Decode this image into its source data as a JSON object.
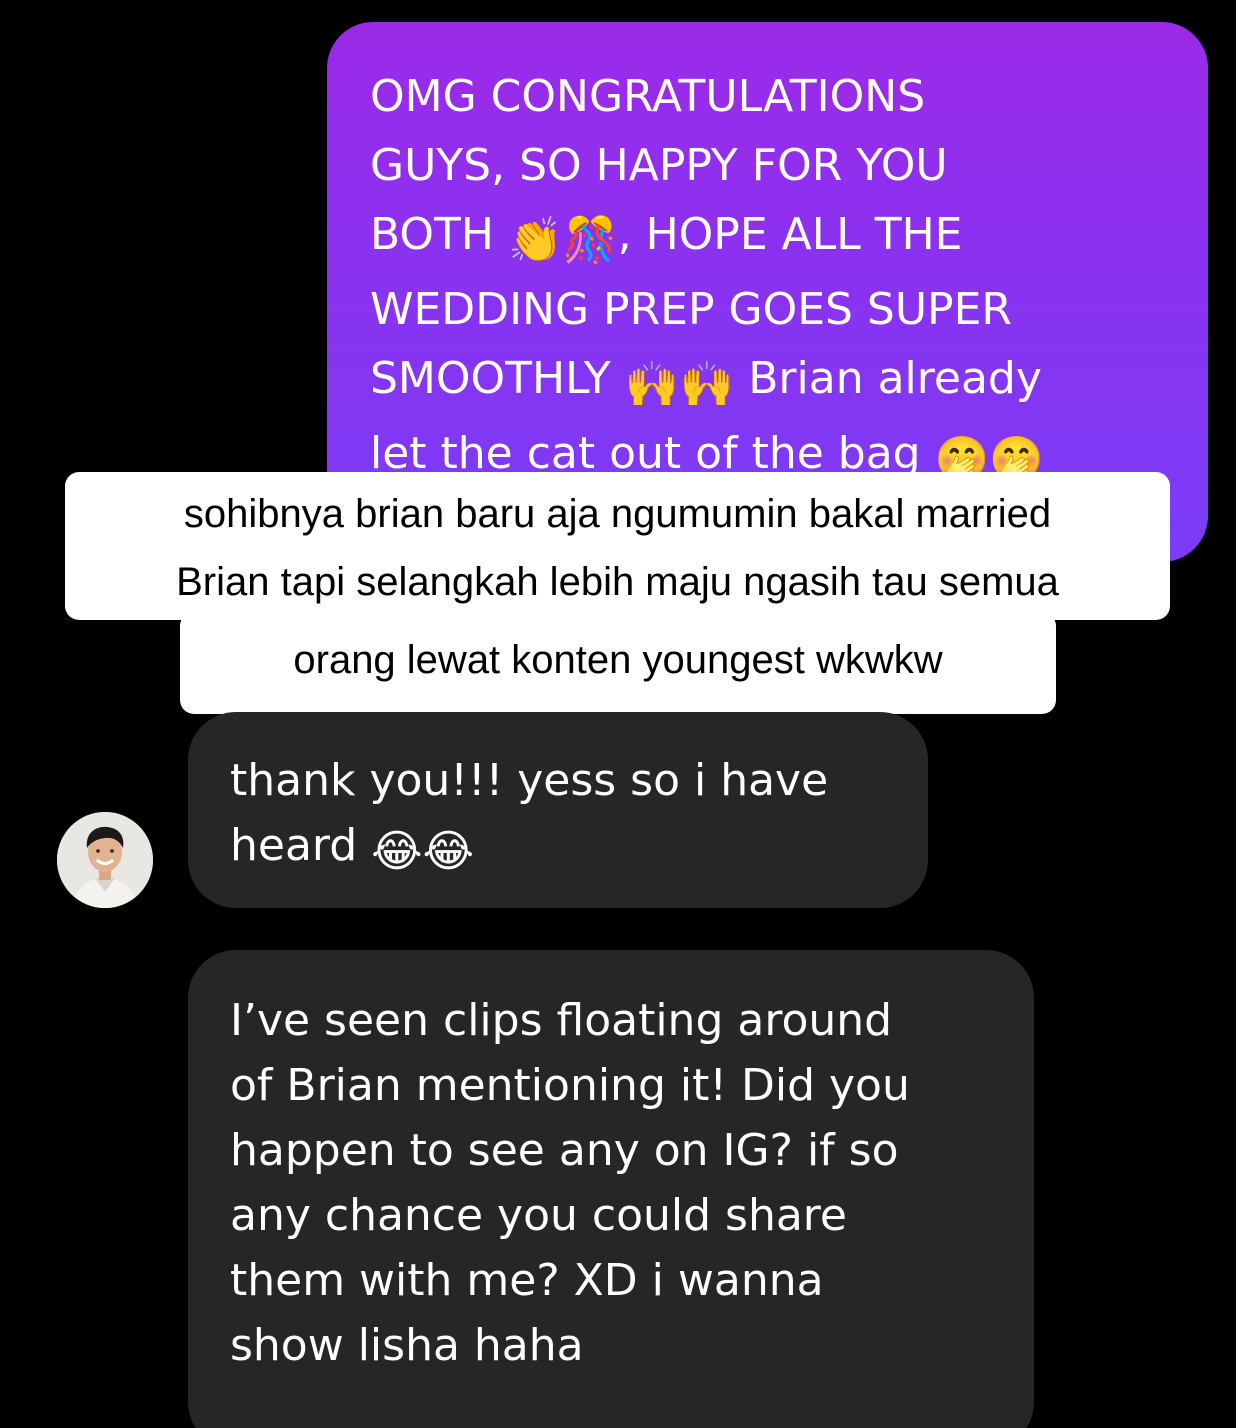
{
  "sent_message": {
    "line1": "OMG CONGRATULATIONS",
    "line2": "GUYS, SO HAPPY FOR YOU",
    "line3_before": "BOTH ",
    "line3_after": ", HOPE ALL THE",
    "line4": "WEDDING PREP GOES SUPER",
    "line5_before": "SMOOTHLY ",
    "line5_after": " Brian already",
    "line6": "let the cat out of the bag ",
    "emoji_clap": "👏",
    "emoji_confetti": "🎊",
    "emoji_raised_hands": "🙌",
    "emoji_hand_over_mouth": "🤭"
  },
  "caption": {
    "line1": "sohibnya brian baru aja ngumumin bakal married",
    "line2": "Brian tapi selangkah lebih maju ngasih tau semua",
    "line3": "orang lewat konten youngest wkwkw"
  },
  "received_messages": {
    "first_line1": "thank you!!! yess so i have",
    "first_line2": "heard ",
    "emoji_laugh": "😂",
    "second_line1": "I’ve seen clips floating around",
    "second_line2": "of Brian mentioning it! Did you",
    "second_line3": "happen to see any on IG? if so",
    "second_line4": "any chance you could share",
    "second_line5": "them with me? XD i wanna",
    "second_line6": "show lisha haha"
  },
  "colors": {
    "sent_gradient_top": "#9b2ae8",
    "sent_gradient_bottom": "#7b3cf6",
    "received_bubble": "#262628",
    "background": "#000000",
    "caption_background": "#ffffff"
  },
  "icons": {
    "avatar": "contact-avatar-photo"
  }
}
